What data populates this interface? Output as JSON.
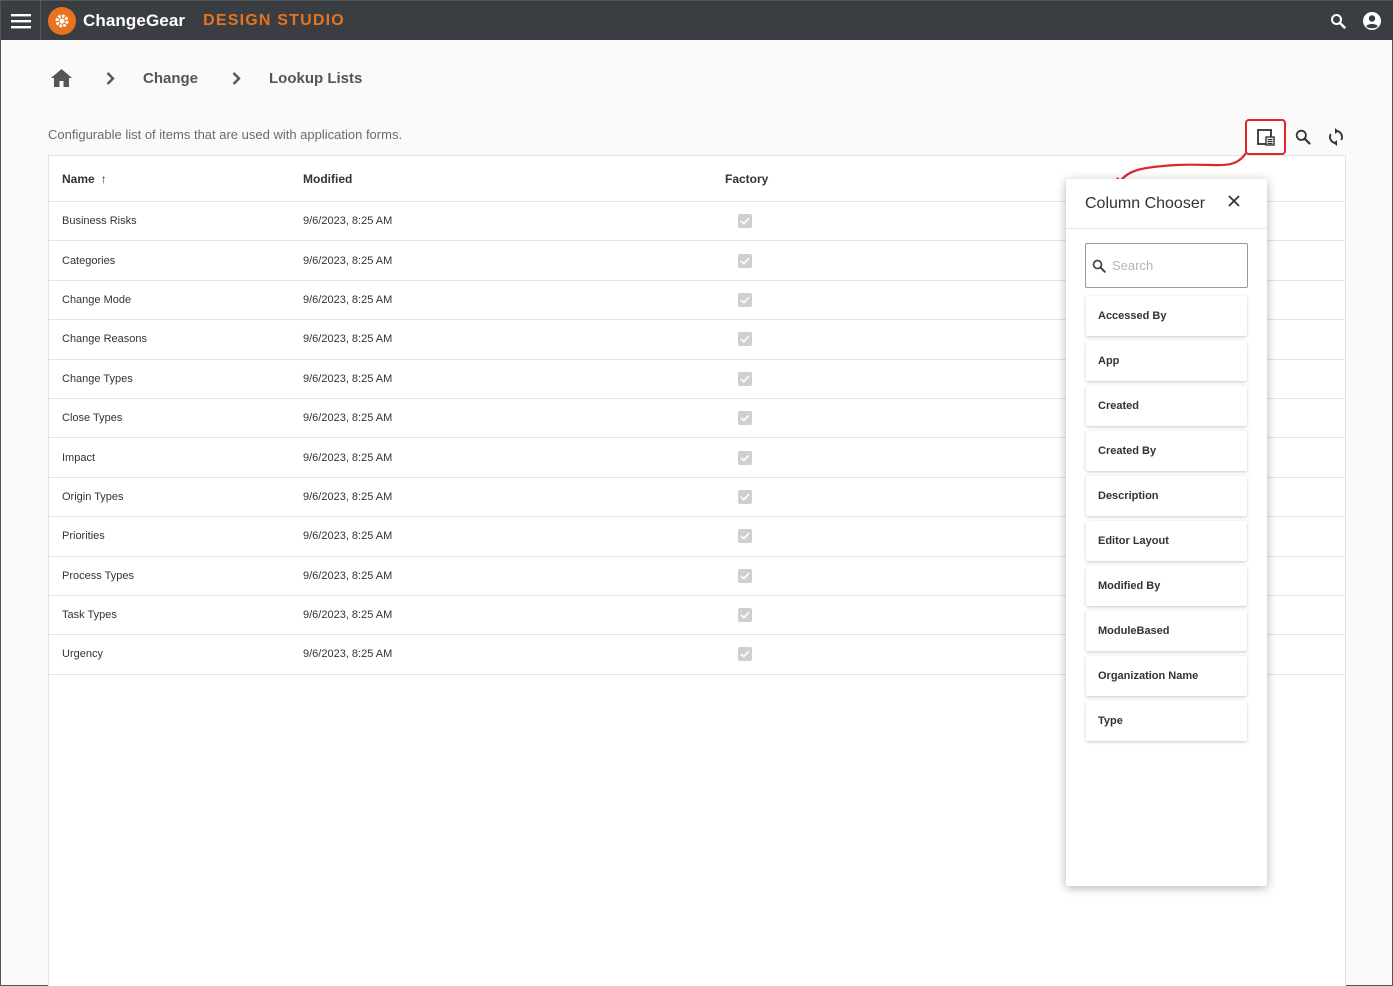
{
  "header": {
    "brand": "ChangeGear",
    "product": "DESIGN STUDIO"
  },
  "breadcrumb": {
    "items": [
      "Change",
      "Lookup Lists"
    ]
  },
  "description": "Configurable list of items that are used with application forms.",
  "grid": {
    "columns": {
      "name": "Name",
      "modified": "Modified",
      "factory": "Factory"
    },
    "sort_indicator": "↑",
    "rows": [
      {
        "name": "Business Risks",
        "modified": "9/6/2023, 8:25 AM",
        "factory": true
      },
      {
        "name": "Categories",
        "modified": "9/6/2023, 8:25 AM",
        "factory": true
      },
      {
        "name": "Change Mode",
        "modified": "9/6/2023, 8:25 AM",
        "factory": true
      },
      {
        "name": "Change Reasons",
        "modified": "9/6/2023, 8:25 AM",
        "factory": true
      },
      {
        "name": "Change Types",
        "modified": "9/6/2023, 8:25 AM",
        "factory": true
      },
      {
        "name": "Close Types",
        "modified": "9/6/2023, 8:25 AM",
        "factory": true
      },
      {
        "name": "Impact",
        "modified": "9/6/2023, 8:25 AM",
        "factory": true
      },
      {
        "name": "Origin Types",
        "modified": "9/6/2023, 8:25 AM",
        "factory": true
      },
      {
        "name": "Priorities",
        "modified": "9/6/2023, 8:25 AM",
        "factory": true
      },
      {
        "name": "Process Types",
        "modified": "9/6/2023, 8:25 AM",
        "factory": true
      },
      {
        "name": "Task Types",
        "modified": "9/6/2023, 8:25 AM",
        "factory": true
      },
      {
        "name": "Urgency",
        "modified": "9/6/2023, 8:25 AM",
        "factory": true
      }
    ]
  },
  "chooser": {
    "title": "Column Chooser",
    "search_placeholder": "Search",
    "items": [
      "Accessed By",
      "App",
      "Created",
      "Created By",
      "Description",
      "Editor Layout",
      "Modified By",
      "ModuleBased",
      "Organization Name",
      "Type"
    ]
  },
  "colors": {
    "topbar": "#3a3d42",
    "accent": "#e8731f",
    "highlight": "#e0262b"
  }
}
